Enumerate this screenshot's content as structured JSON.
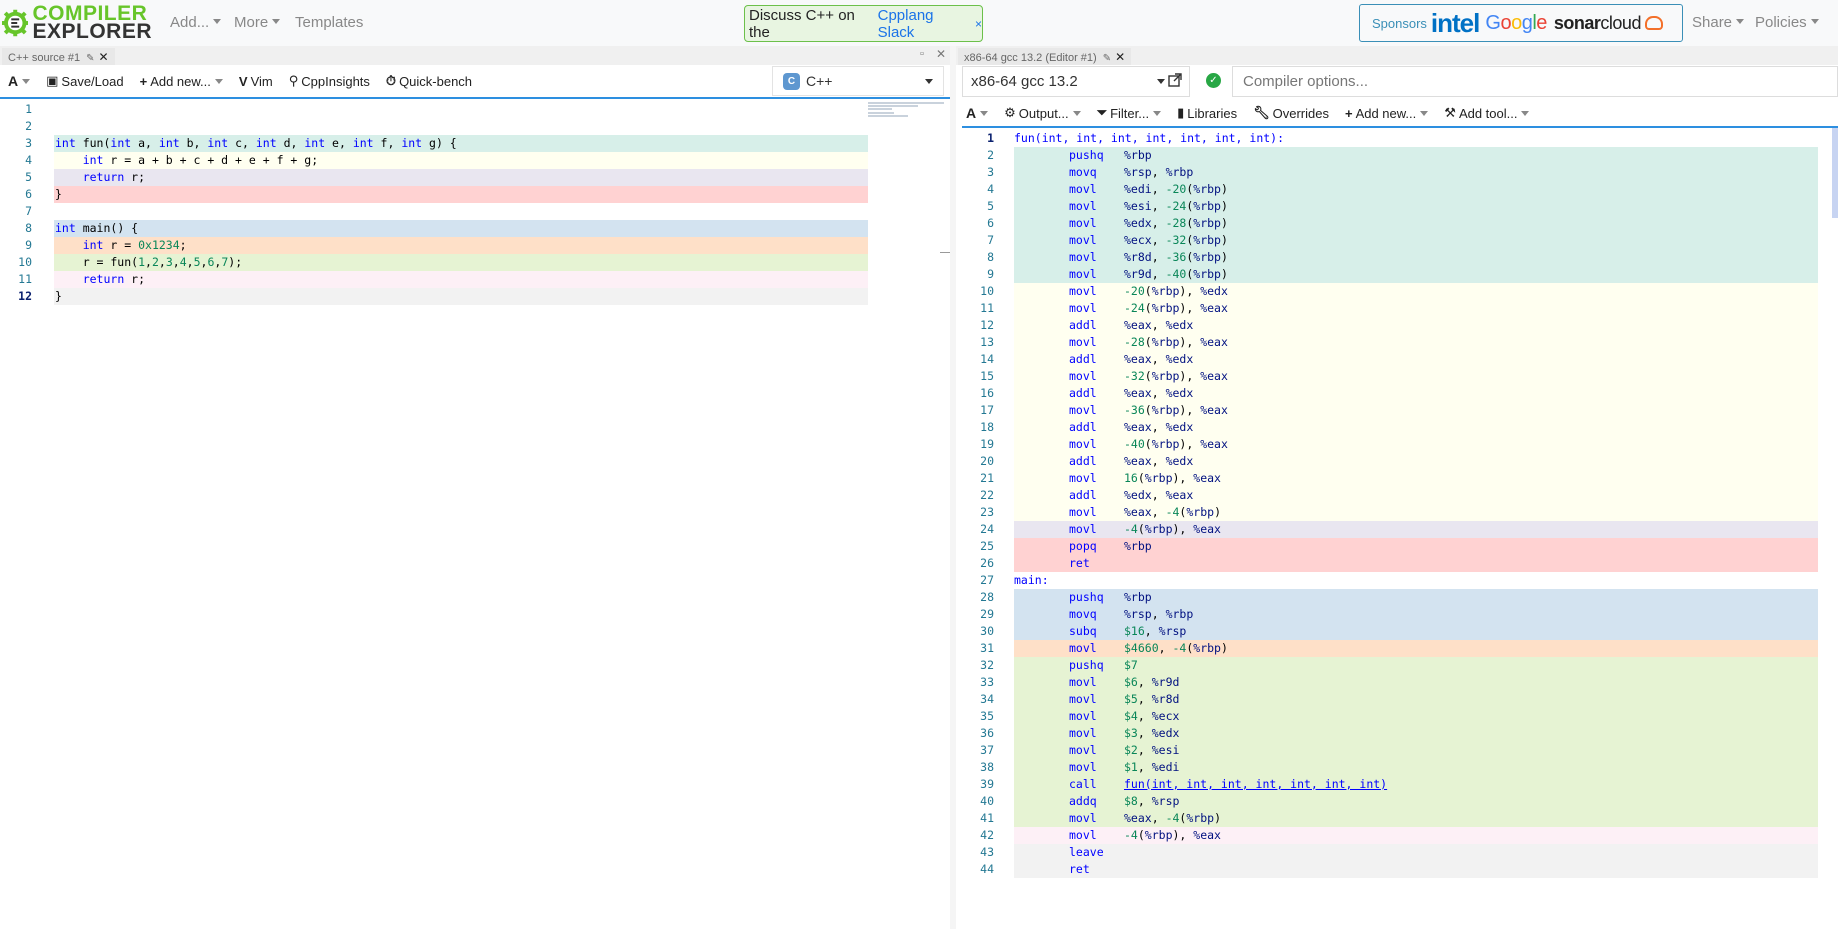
{
  "navbar": {
    "logo_line1": "COMPILER",
    "logo_line2": "EXPLORER",
    "add": "Add...",
    "more": "More",
    "templates": "Templates",
    "slack_prefix": "Discuss C++ on the",
    "slack_link": "Cpplang Slack",
    "slack_close": "×",
    "sponsors_label": "Sponsors",
    "sponsor_intel": "intel",
    "sponsor_google": "Google",
    "sponsor_sonar_bold": "sonar",
    "sponsor_sonar_rest": "cloud",
    "share": "Share",
    "policies": "Policies"
  },
  "source": {
    "tab_title": "C++ source #1",
    "font_btn": "A",
    "save_load": "Save/Load",
    "add_new": "Add new...",
    "vim": "Vim",
    "cppinsights": "CppInsights",
    "quickbench": "Quick-bench",
    "language": "C++",
    "language_badge": "C",
    "lines": [
      "",
      "",
      "int fun(int a, int b, int c, int d, int e, int f, int g) {",
      "    int r = a + b + c + d + e + f + g;",
      "    return r;",
      "}",
      "",
      "int main() {",
      "    int r = 0x1234;",
      "    r = fun(1,2,3,4,5,6,7);",
      "    return r;",
      "}"
    ],
    "line_colors": [
      "",
      "",
      "#d7efe9",
      "#fffff0",
      "#e9e6f0",
      "#ffd2d2",
      "",
      "#d3e3f0",
      "#fee0c8",
      "#e6f3d3",
      "#fdf0f6",
      "#f2f2f2"
    ]
  },
  "compiler": {
    "tab_title": "x86-64 gcc 13.2 (Editor #1)",
    "compiler_name": "x86-64 gcc 13.2",
    "options_placeholder": "Compiler options...",
    "font_btn": "A",
    "output": "Output...",
    "filter": "Filter...",
    "libraries": "Libraries",
    "overrides": "Overrides",
    "add_new": "Add new...",
    "add_tool": "Add tool...",
    "asm": [
      [
        "fun(int, int, int, int, int, int, int):",
        "",
        ""
      ],
      [
        "",
        "pushq",
        "%rbp"
      ],
      [
        "",
        "movq",
        "%rsp, %rbp"
      ],
      [
        "",
        "movl",
        "%edi, -20(%rbp)"
      ],
      [
        "",
        "movl",
        "%esi, -24(%rbp)"
      ],
      [
        "",
        "movl",
        "%edx, -28(%rbp)"
      ],
      [
        "",
        "movl",
        "%ecx, -32(%rbp)"
      ],
      [
        "",
        "movl",
        "%r8d, -36(%rbp)"
      ],
      [
        "",
        "movl",
        "%r9d, -40(%rbp)"
      ],
      [
        "",
        "movl",
        "-20(%rbp), %edx"
      ],
      [
        "",
        "movl",
        "-24(%rbp), %eax"
      ],
      [
        "",
        "addl",
        "%eax, %edx"
      ],
      [
        "",
        "movl",
        "-28(%rbp), %eax"
      ],
      [
        "",
        "addl",
        "%eax, %edx"
      ],
      [
        "",
        "movl",
        "-32(%rbp), %eax"
      ],
      [
        "",
        "addl",
        "%eax, %edx"
      ],
      [
        "",
        "movl",
        "-36(%rbp), %eax"
      ],
      [
        "",
        "addl",
        "%eax, %edx"
      ],
      [
        "",
        "movl",
        "-40(%rbp), %eax"
      ],
      [
        "",
        "addl",
        "%eax, %edx"
      ],
      [
        "",
        "movl",
        "16(%rbp), %eax"
      ],
      [
        "",
        "addl",
        "%edx, %eax"
      ],
      [
        "",
        "movl",
        "%eax, -4(%rbp)"
      ],
      [
        "",
        "movl",
        "-4(%rbp), %eax"
      ],
      [
        "",
        "popq",
        "%rbp"
      ],
      [
        "",
        "ret",
        ""
      ],
      [
        "main:",
        "",
        ""
      ],
      [
        "",
        "pushq",
        "%rbp"
      ],
      [
        "",
        "movq",
        "%rsp, %rbp"
      ],
      [
        "",
        "subq",
        "$16, %rsp"
      ],
      [
        "",
        "movl",
        "$4660, -4(%rbp)"
      ],
      [
        "",
        "pushq",
        "$7"
      ],
      [
        "",
        "movl",
        "$6, %r9d"
      ],
      [
        "",
        "movl",
        "$5, %r8d"
      ],
      [
        "",
        "movl",
        "$4, %ecx"
      ],
      [
        "",
        "movl",
        "$3, %edx"
      ],
      [
        "",
        "movl",
        "$2, %esi"
      ],
      [
        "",
        "movl",
        "$1, %edi"
      ],
      [
        "",
        "call",
        "fun(int, int, int, int, int, int, int)"
      ],
      [
        "",
        "addq",
        "$8, %rsp"
      ],
      [
        "",
        "movl",
        "%eax, -4(%rbp)"
      ],
      [
        "",
        "movl",
        "-4(%rbp), %eax"
      ],
      [
        "",
        "leave",
        ""
      ],
      [
        "",
        "ret",
        ""
      ]
    ],
    "asm_colors": [
      "",
      "#d7efe9",
      "#d7efe9",
      "#d7efe9",
      "#d7efe9",
      "#d7efe9",
      "#d7efe9",
      "#d7efe9",
      "#d7efe9",
      "#fffff0",
      "#fffff0",
      "#fffff0",
      "#fffff0",
      "#fffff0",
      "#fffff0",
      "#fffff0",
      "#fffff0",
      "#fffff0",
      "#fffff0",
      "#fffff0",
      "#fffff0",
      "#fffff0",
      "#fffff0",
      "#e9e6f0",
      "#ffd2d2",
      "#ffd2d2",
      "",
      "#d3e3f0",
      "#d3e3f0",
      "#d3e3f0",
      "#fee0c8",
      "#e6f3d3",
      "#e6f3d3",
      "#e6f3d3",
      "#e6f3d3",
      "#e6f3d3",
      "#e6f3d3",
      "#e6f3d3",
      "#e6f3d3",
      "#e6f3d3",
      "#e6f3d3",
      "#fdf0f6",
      "#f2f2f2",
      "#f2f2f2"
    ]
  }
}
